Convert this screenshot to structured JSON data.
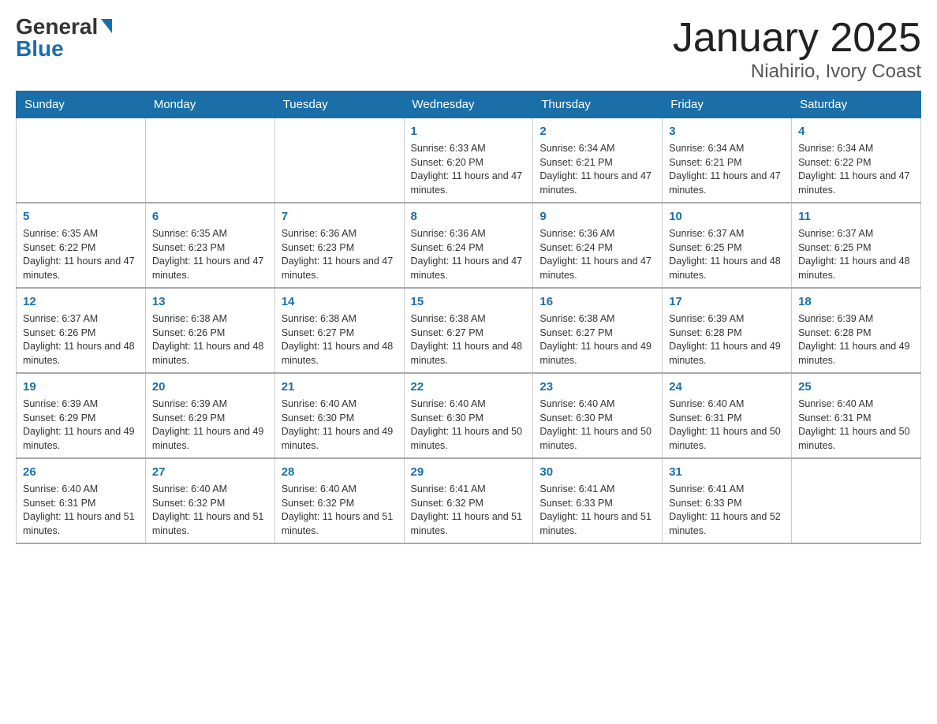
{
  "header": {
    "logo_general": "General",
    "logo_blue": "Blue",
    "title": "January 2025",
    "subtitle": "Niahirio, Ivory Coast"
  },
  "days_of_week": [
    "Sunday",
    "Monday",
    "Tuesday",
    "Wednesday",
    "Thursday",
    "Friday",
    "Saturday"
  ],
  "weeks": [
    [
      {
        "day": "",
        "info": ""
      },
      {
        "day": "",
        "info": ""
      },
      {
        "day": "",
        "info": ""
      },
      {
        "day": "1",
        "info": "Sunrise: 6:33 AM\nSunset: 6:20 PM\nDaylight: 11 hours and 47 minutes."
      },
      {
        "day": "2",
        "info": "Sunrise: 6:34 AM\nSunset: 6:21 PM\nDaylight: 11 hours and 47 minutes."
      },
      {
        "day": "3",
        "info": "Sunrise: 6:34 AM\nSunset: 6:21 PM\nDaylight: 11 hours and 47 minutes."
      },
      {
        "day": "4",
        "info": "Sunrise: 6:34 AM\nSunset: 6:22 PM\nDaylight: 11 hours and 47 minutes."
      }
    ],
    [
      {
        "day": "5",
        "info": "Sunrise: 6:35 AM\nSunset: 6:22 PM\nDaylight: 11 hours and 47 minutes."
      },
      {
        "day": "6",
        "info": "Sunrise: 6:35 AM\nSunset: 6:23 PM\nDaylight: 11 hours and 47 minutes."
      },
      {
        "day": "7",
        "info": "Sunrise: 6:36 AM\nSunset: 6:23 PM\nDaylight: 11 hours and 47 minutes."
      },
      {
        "day": "8",
        "info": "Sunrise: 6:36 AM\nSunset: 6:24 PM\nDaylight: 11 hours and 47 minutes."
      },
      {
        "day": "9",
        "info": "Sunrise: 6:36 AM\nSunset: 6:24 PM\nDaylight: 11 hours and 47 minutes."
      },
      {
        "day": "10",
        "info": "Sunrise: 6:37 AM\nSunset: 6:25 PM\nDaylight: 11 hours and 48 minutes."
      },
      {
        "day": "11",
        "info": "Sunrise: 6:37 AM\nSunset: 6:25 PM\nDaylight: 11 hours and 48 minutes."
      }
    ],
    [
      {
        "day": "12",
        "info": "Sunrise: 6:37 AM\nSunset: 6:26 PM\nDaylight: 11 hours and 48 minutes."
      },
      {
        "day": "13",
        "info": "Sunrise: 6:38 AM\nSunset: 6:26 PM\nDaylight: 11 hours and 48 minutes."
      },
      {
        "day": "14",
        "info": "Sunrise: 6:38 AM\nSunset: 6:27 PM\nDaylight: 11 hours and 48 minutes."
      },
      {
        "day": "15",
        "info": "Sunrise: 6:38 AM\nSunset: 6:27 PM\nDaylight: 11 hours and 48 minutes."
      },
      {
        "day": "16",
        "info": "Sunrise: 6:38 AM\nSunset: 6:27 PM\nDaylight: 11 hours and 49 minutes."
      },
      {
        "day": "17",
        "info": "Sunrise: 6:39 AM\nSunset: 6:28 PM\nDaylight: 11 hours and 49 minutes."
      },
      {
        "day": "18",
        "info": "Sunrise: 6:39 AM\nSunset: 6:28 PM\nDaylight: 11 hours and 49 minutes."
      }
    ],
    [
      {
        "day": "19",
        "info": "Sunrise: 6:39 AM\nSunset: 6:29 PM\nDaylight: 11 hours and 49 minutes."
      },
      {
        "day": "20",
        "info": "Sunrise: 6:39 AM\nSunset: 6:29 PM\nDaylight: 11 hours and 49 minutes."
      },
      {
        "day": "21",
        "info": "Sunrise: 6:40 AM\nSunset: 6:30 PM\nDaylight: 11 hours and 49 minutes."
      },
      {
        "day": "22",
        "info": "Sunrise: 6:40 AM\nSunset: 6:30 PM\nDaylight: 11 hours and 50 minutes."
      },
      {
        "day": "23",
        "info": "Sunrise: 6:40 AM\nSunset: 6:30 PM\nDaylight: 11 hours and 50 minutes."
      },
      {
        "day": "24",
        "info": "Sunrise: 6:40 AM\nSunset: 6:31 PM\nDaylight: 11 hours and 50 minutes."
      },
      {
        "day": "25",
        "info": "Sunrise: 6:40 AM\nSunset: 6:31 PM\nDaylight: 11 hours and 50 minutes."
      }
    ],
    [
      {
        "day": "26",
        "info": "Sunrise: 6:40 AM\nSunset: 6:31 PM\nDaylight: 11 hours and 51 minutes."
      },
      {
        "day": "27",
        "info": "Sunrise: 6:40 AM\nSunset: 6:32 PM\nDaylight: 11 hours and 51 minutes."
      },
      {
        "day": "28",
        "info": "Sunrise: 6:40 AM\nSunset: 6:32 PM\nDaylight: 11 hours and 51 minutes."
      },
      {
        "day": "29",
        "info": "Sunrise: 6:41 AM\nSunset: 6:32 PM\nDaylight: 11 hours and 51 minutes."
      },
      {
        "day": "30",
        "info": "Sunrise: 6:41 AM\nSunset: 6:33 PM\nDaylight: 11 hours and 51 minutes."
      },
      {
        "day": "31",
        "info": "Sunrise: 6:41 AM\nSunset: 6:33 PM\nDaylight: 11 hours and 52 minutes."
      },
      {
        "day": "",
        "info": ""
      }
    ]
  ]
}
